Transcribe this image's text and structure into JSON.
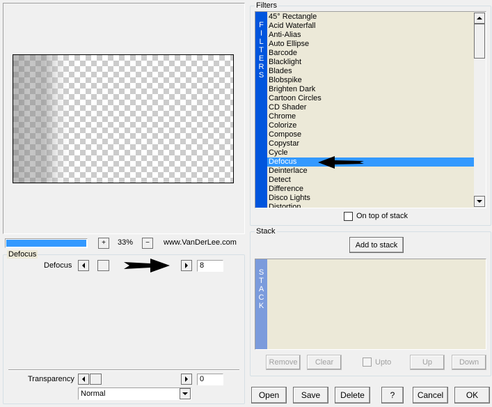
{
  "filters": {
    "group_label": "Filters",
    "side_label": [
      "F",
      "I",
      "L",
      "T",
      "E",
      "R",
      "S"
    ],
    "items": [
      "45° Rectangle",
      "Acid Waterfall",
      "Anti-Alias",
      "Auto Ellipse",
      "Barcode",
      "Blacklight",
      "Blades",
      "Blobspike",
      "Brighten Dark",
      "Cartoon Circles",
      "CD Shader",
      "Chrome",
      "Colorize",
      "Compose",
      "Copystar",
      "Cycle",
      "Defocus",
      "Deinterlace",
      "Detect",
      "Difference",
      "Disco Lights",
      "Distortion"
    ],
    "selected": "Defocus",
    "on_top_label": "On top of stack",
    "on_top_checked": false
  },
  "stack": {
    "group_label": "Stack",
    "add_label": "Add to stack",
    "side_label": [
      "S",
      "T",
      "A",
      "C",
      "K"
    ],
    "remove_label": "Remove",
    "clear_label": "Clear",
    "upto_label": "Upto",
    "up_label": "Up",
    "down_label": "Down"
  },
  "preview": {
    "zoom_in_label": "+",
    "zoom_value": "33%",
    "zoom_out_label": "−",
    "website": "www.VanDerLee.com"
  },
  "defocus": {
    "group_label": "Defocus",
    "param_label": "Defocus",
    "value": "8",
    "level": 0.1
  },
  "transparency": {
    "label": "Transparency",
    "value": "0",
    "level": 0.0,
    "mode": "Normal"
  },
  "buttons": {
    "open": "Open",
    "save": "Save",
    "delete": "Delete",
    "help": "?",
    "cancel": "Cancel",
    "ok": "OK"
  },
  "colors": {
    "accent": "#3399ff",
    "side_bar_blue": "#0055dd",
    "stack_bar": "#7b9bdc",
    "list_bg": "#ece9d8"
  }
}
